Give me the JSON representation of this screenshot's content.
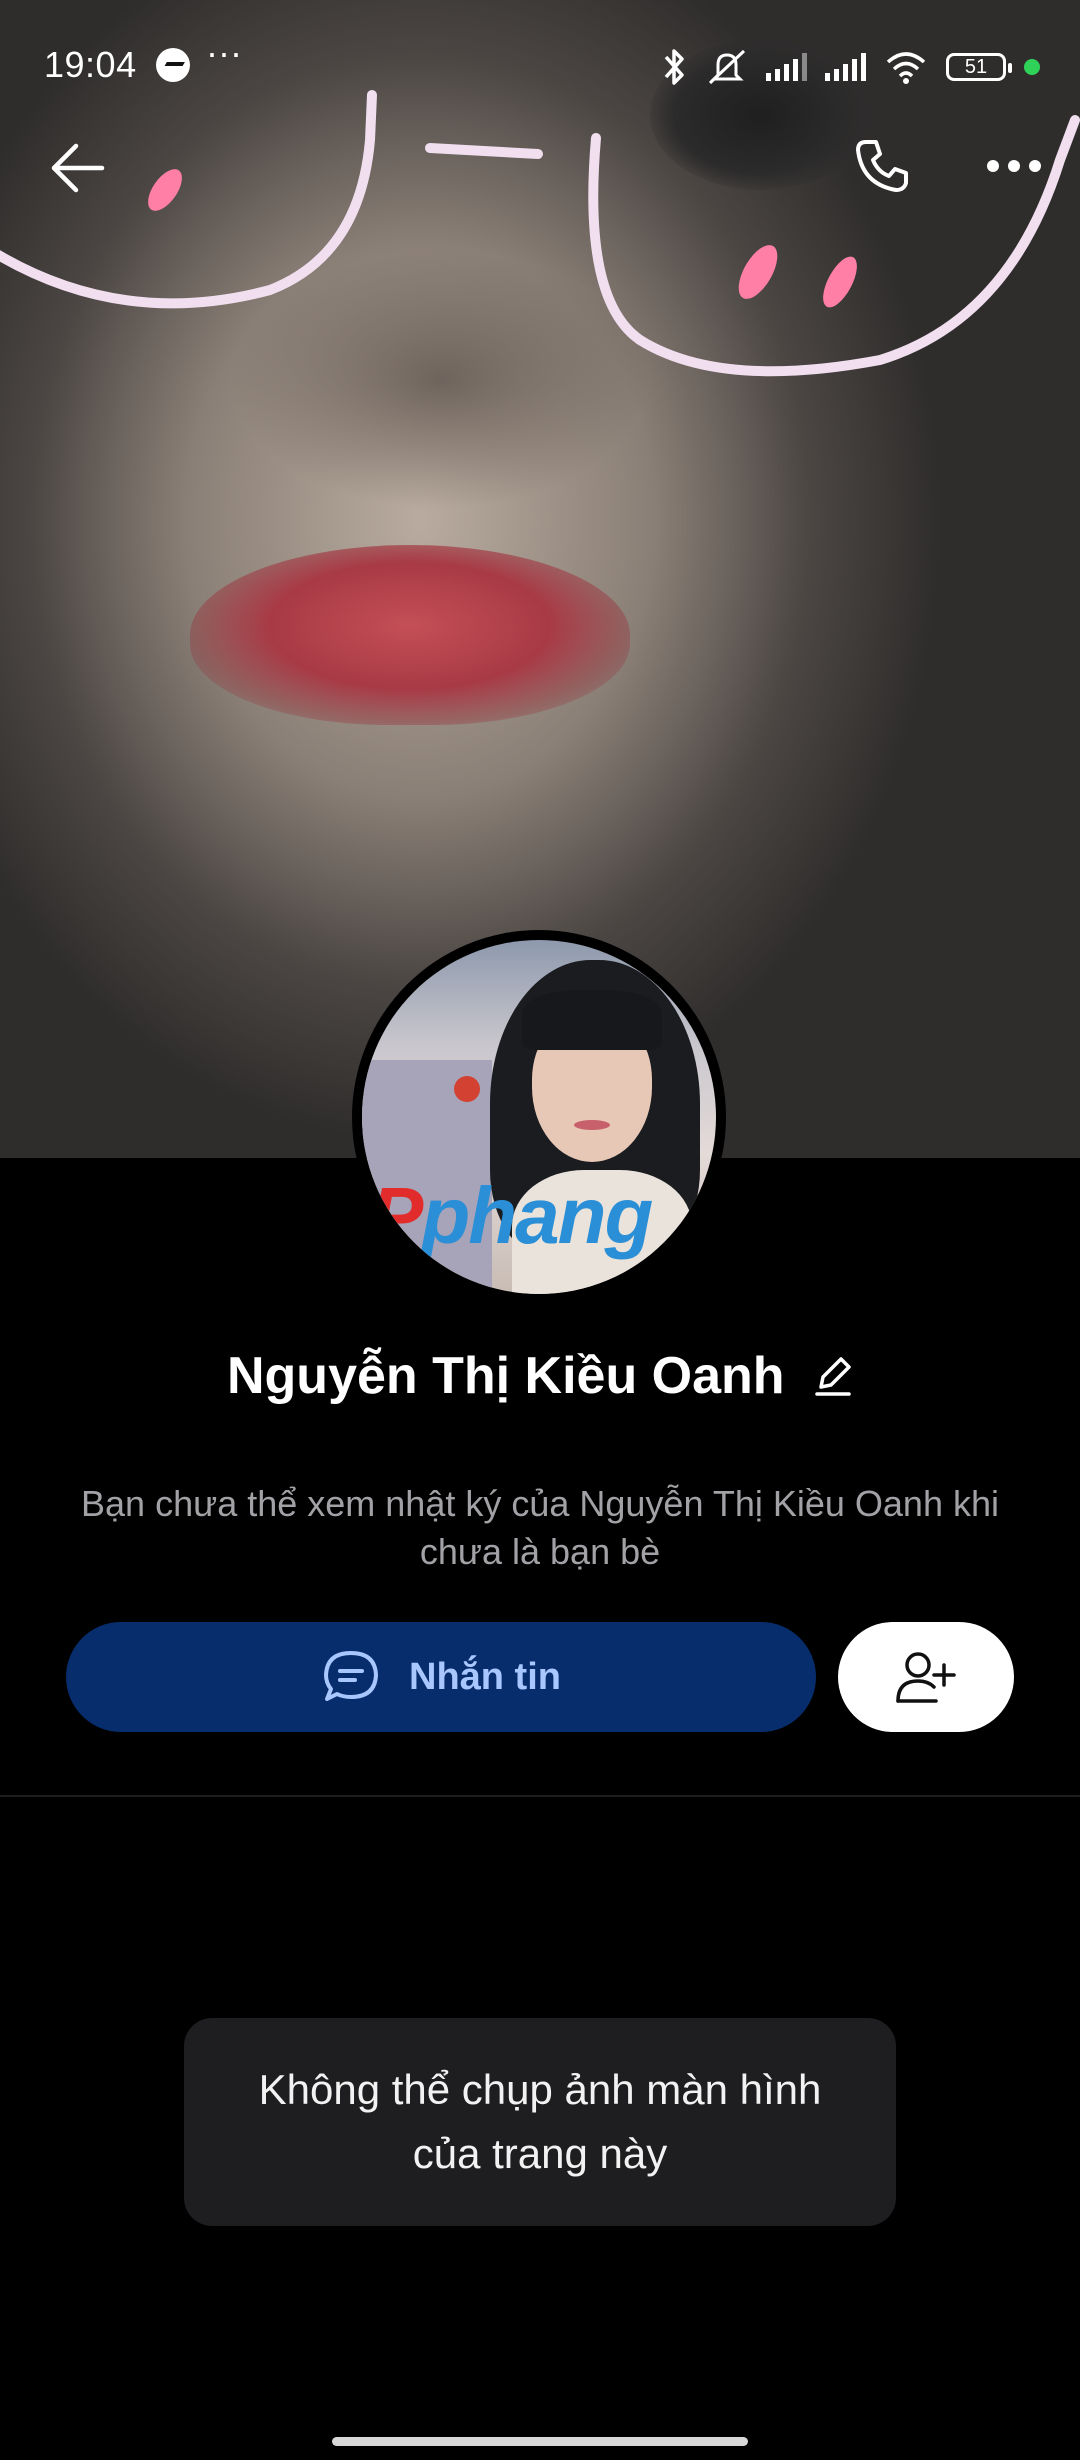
{
  "status_bar": {
    "time": "19:04",
    "notification_app_icon": "messenger-icon",
    "more_notifications": "···",
    "battery": "51",
    "icons": [
      "bluetooth-icon",
      "vibrate-off-icon",
      "signal-icon",
      "signal-icon",
      "wifi-icon",
      "battery-icon",
      "active-dot"
    ]
  },
  "top_nav": {
    "back_icon": "arrow-left-icon",
    "call_icon": "phone-icon",
    "more_icon": "more-horizontal-icon"
  },
  "profile": {
    "name": "Nguyễn Thị Kiều Oanh",
    "avatar_watermark_part1": "P",
    "avatar_watermark_part2": "phang",
    "description": "Bạn chưa thể xem nhật ký của Nguyễn Thị Kiều Oanh khi chưa là bạn bè"
  },
  "actions": {
    "message_label": "Nhắn tin",
    "message_icon": "chat-bubble-icon",
    "add_friend_icon": "add-person-icon"
  },
  "toast": {
    "text": "Không thể chụp ảnh màn hình của trang này"
  },
  "colors": {
    "message_button_bg": "#082d6c",
    "message_button_text": "#a9c7ff",
    "background": "#000000",
    "toast_bg": "#1e1e20"
  }
}
